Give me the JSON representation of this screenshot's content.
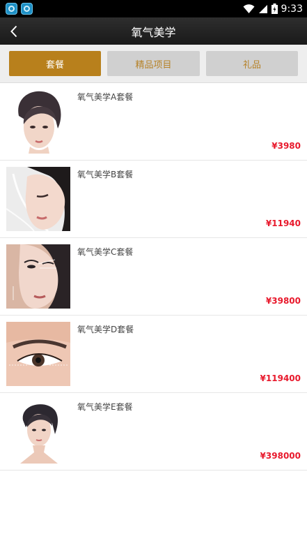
{
  "status_bar": {
    "time": "9:33"
  },
  "header": {
    "title": "氧气美学"
  },
  "tabs": [
    {
      "label": "套餐",
      "active": true
    },
    {
      "label": "精品项目",
      "active": false
    },
    {
      "label": "礼品",
      "active": false
    }
  ],
  "packages": [
    {
      "name": "氧气美学A套餐",
      "price": "¥3980"
    },
    {
      "name": "氧气美学B套餐",
      "price": "¥11940"
    },
    {
      "name": "氧气美学C套餐",
      "price": "¥39800"
    },
    {
      "name": "氧气美学D套餐",
      "price": "¥119400"
    },
    {
      "name": "氧气美学E套餐",
      "price": "¥398000"
    }
  ],
  "colors": {
    "accent": "#b8801c",
    "price": "#e8192c",
    "tab_inactive_bg": "#d0d0d0"
  }
}
